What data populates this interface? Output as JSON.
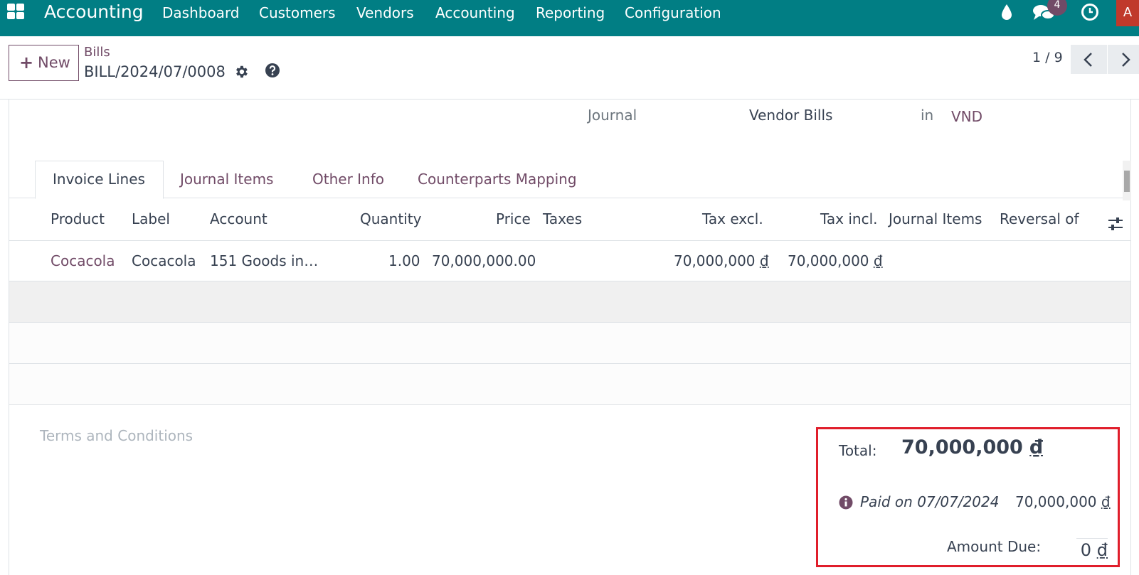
{
  "navbar": {
    "app_name": "Accounting",
    "menu": [
      "Dashboard",
      "Customers",
      "Vendors",
      "Accounting",
      "Reporting",
      "Configuration"
    ],
    "messages_badge": "4",
    "avatar_letter": "A",
    "icons": [
      "apps-icon",
      "drop-icon",
      "chat-icon",
      "clock-icon"
    ]
  },
  "control_panel": {
    "new_label": "New",
    "breadcrumb": "Bills",
    "record_name": "BILL/2024/07/0008",
    "pager": "1 / 9"
  },
  "header": {
    "journal_label": "Journal",
    "journal_value": "Vendor Bills",
    "in_label": "in",
    "currency": "VND"
  },
  "tabs": [
    "Invoice Lines",
    "Journal Items",
    "Other Info",
    "Counterparts Mapping"
  ],
  "table": {
    "columns": [
      "Product",
      "Label",
      "Account",
      "Quantity",
      "Price",
      "Taxes",
      "Tax excl.",
      "Tax incl.",
      "Journal Items",
      "Reversal of"
    ],
    "rows": [
      {
        "product": "Cocacola",
        "label": "Cocacola",
        "account": "151 Goods in…",
        "quantity": "1.00",
        "price": "70,000,000.00",
        "taxes": "",
        "tax_excl_amount": "70,000,000",
        "tax_incl_amount": "70,000,000",
        "currency_symbol": "₫"
      }
    ]
  },
  "footer": {
    "terms_placeholder": "Terms and Conditions"
  },
  "totals": {
    "total_label": "Total:",
    "total_amount": "70,000,000",
    "paid_label": "Paid on 07/07/2024",
    "paid_amount": "70,000,000",
    "amount_due_label": "Amount Due:",
    "amount_due": "0",
    "currency_symbol": "₫"
  },
  "colors": {
    "navbar": "#017e84",
    "accent": "#714b67",
    "highlight_border": "#e01e2b"
  }
}
